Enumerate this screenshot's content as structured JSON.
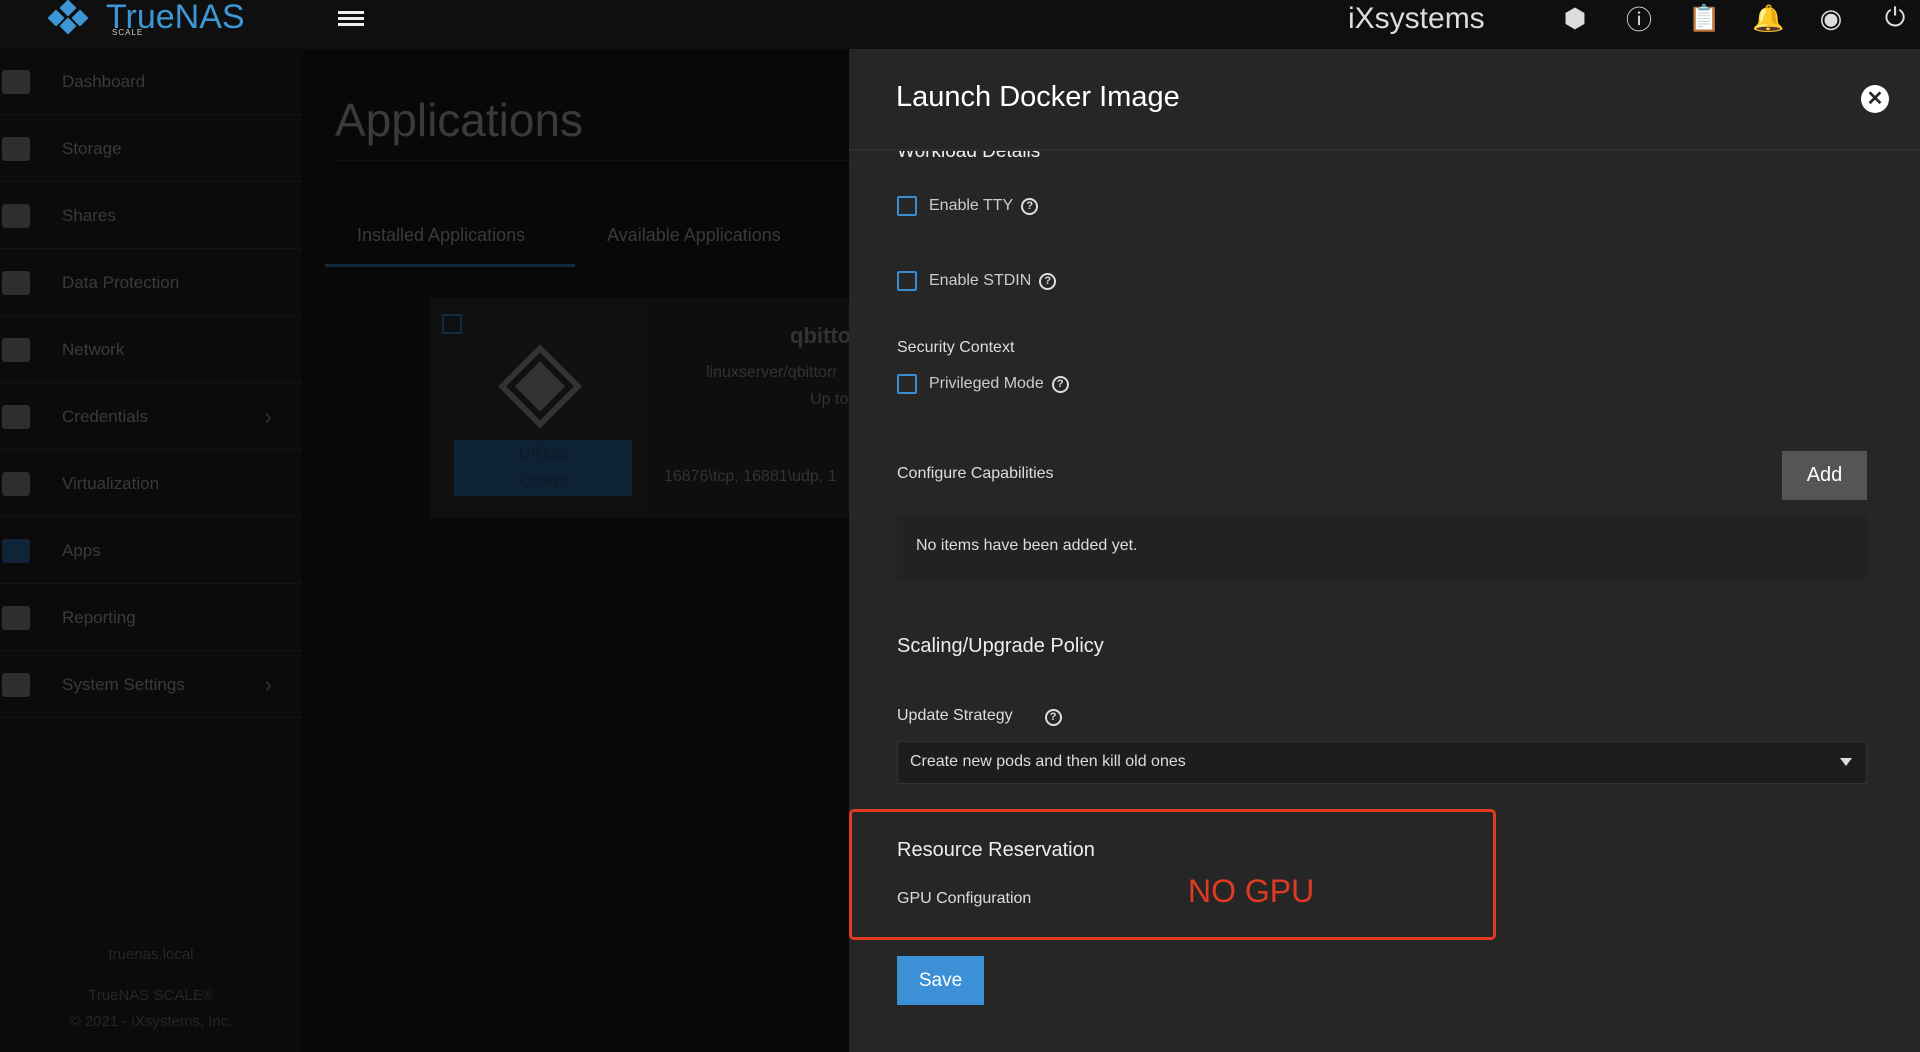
{
  "topbar": {
    "brand": "TrueNAS",
    "brand_sub": "SCALE",
    "vendor": "iXsystems",
    "icons": [
      "truecommand-icon",
      "info-icon",
      "clipboard-icon",
      "bell-icon",
      "account-icon",
      "power-icon"
    ]
  },
  "sidebar": {
    "items": [
      {
        "label": "Dashboard"
      },
      {
        "label": "Storage"
      },
      {
        "label": "Shares"
      },
      {
        "label": "Data Protection"
      },
      {
        "label": "Network"
      },
      {
        "label": "Credentials",
        "chevron": true
      },
      {
        "label": "Virtualization"
      },
      {
        "label": "Apps"
      },
      {
        "label": "Reporting"
      },
      {
        "label": "System Settings",
        "chevron": true
      }
    ],
    "hostname": "truenas.local",
    "product": "TrueNAS SCALE®",
    "copyright": "© 2021 - iXsystems, Inc."
  },
  "main": {
    "title": "Applications",
    "tabs": [
      {
        "label": "Installed Applications",
        "active": true
      },
      {
        "label": "Available Applications"
      }
    ],
    "card": {
      "name": "qbitto",
      "image": "linuxserver/qbittorr",
      "status": "Up to",
      "badge_line1": "Official",
      "badge_line2": "Charts",
      "ports": "16876\\tcp, 16881\\udp, 1"
    }
  },
  "panel": {
    "title": "Launch Docker Image",
    "section_clipped": "Workload Details",
    "enable_tty": "Enable TTY",
    "enable_stdin": "Enable STDIN",
    "security_context": "Security Context",
    "privileged_mode": "Privileged Mode",
    "configure_capabilities": "Configure Capabilities",
    "add_label": "Add",
    "empty_text": "No items have been added yet.",
    "scaling_heading": "Scaling/Upgrade Policy",
    "update_strategy_label": "Update Strategy",
    "update_strategy_value": "Create new pods and then kill old ones",
    "resource_heading": "Resource Reservation",
    "gpu_label": "GPU Configuration",
    "annotation": "NO GPU",
    "save_label": "Save"
  },
  "colors": {
    "accent": "#3c90d6",
    "annotation": "#e03a22",
    "panel_bg": "#262626"
  }
}
